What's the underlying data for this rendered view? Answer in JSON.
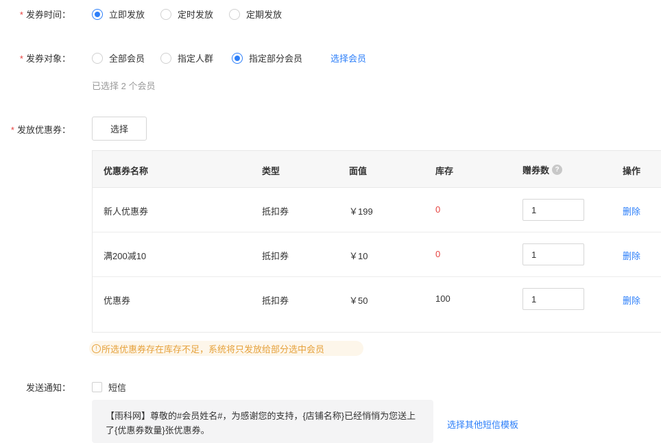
{
  "send_time": {
    "label": "发券时间：",
    "options": [
      "立即发放",
      "定时发放",
      "定期发放"
    ],
    "selected": 0
  },
  "target": {
    "label": "发券对象：",
    "options": [
      "全部会员",
      "指定人群",
      "指定部分会员"
    ],
    "selected": 2,
    "select_link": "选择会员",
    "hint": "已选择 2 个会员"
  },
  "coupons": {
    "label": "发放优惠券：",
    "select_button": "选择",
    "columns": [
      "优惠券名称",
      "类型",
      "面值",
      "库存",
      "赠券数",
      "操作"
    ],
    "rows": [
      {
        "name": "新人优惠券",
        "type": "抵扣券",
        "value": "￥199",
        "stock": "0",
        "stock_low": true,
        "qty": "1",
        "action": "删除"
      },
      {
        "name": "满200减10",
        "type": "抵扣券",
        "value": "￥10",
        "stock": "0",
        "stock_low": true,
        "qty": "1",
        "action": "删除"
      },
      {
        "name": "优惠券",
        "type": "抵扣券",
        "value": "￥50",
        "stock": "100",
        "stock_low": false,
        "qty": "1",
        "action": "删除"
      }
    ],
    "warning": "所选优惠券存在库存不足，系统将只发放给部分选中会员"
  },
  "notify": {
    "label": "发送通知：",
    "sms_label": "短信",
    "sms_checked": false,
    "sms_text": "【雨科网】尊敬的#会员姓名#，为感谢您的支持，{店铺名称}已经悄悄为您送上了{优惠券数量}张优惠券。",
    "other_template_link": "选择其他短信模板"
  },
  "colors": {
    "accent": "#2d7ff9",
    "danger": "#e64340",
    "warning": "#e6a23c"
  }
}
